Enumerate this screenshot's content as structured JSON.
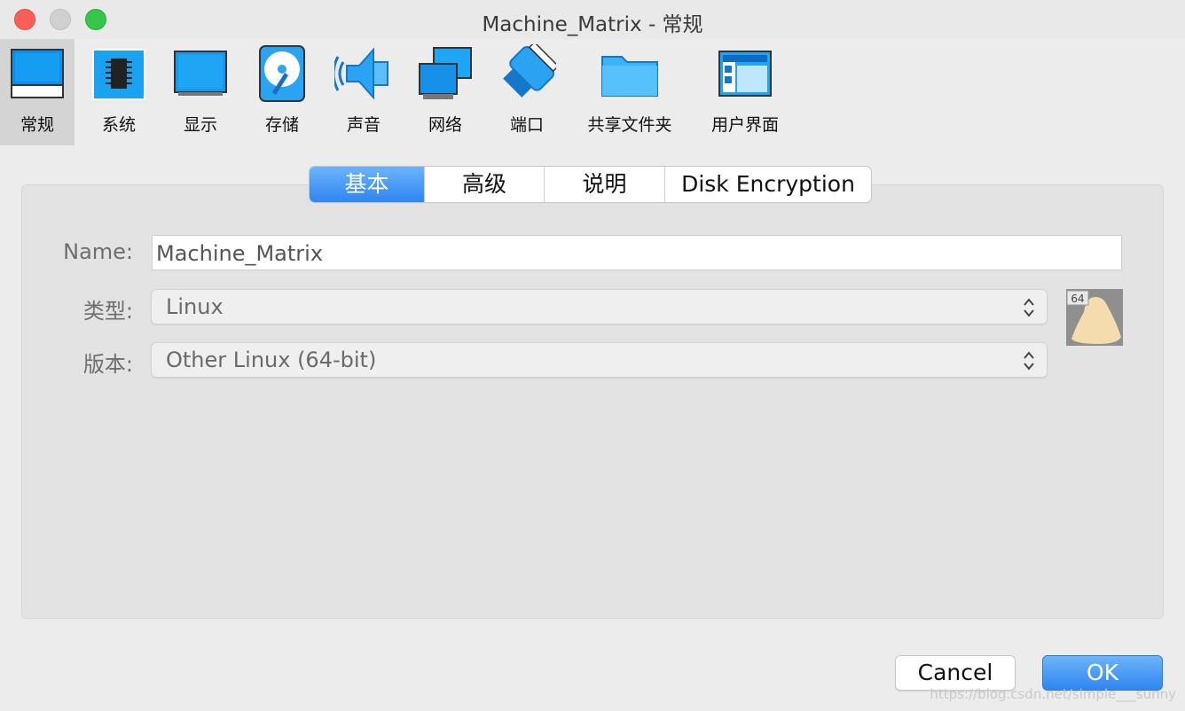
{
  "window": {
    "title": "Machine_Matrix - 常规"
  },
  "toolbar": {
    "items": [
      {
        "label": "常规",
        "icon": "monitor-general-icon"
      },
      {
        "label": "系统",
        "icon": "chip-icon"
      },
      {
        "label": "显示",
        "icon": "display-icon"
      },
      {
        "label": "存储",
        "icon": "storage-disk-icon"
      },
      {
        "label": "声音",
        "icon": "speaker-icon"
      },
      {
        "label": "网络",
        "icon": "network-icon"
      },
      {
        "label": "端口",
        "icon": "port-connector-icon"
      },
      {
        "label": "共享文件夹",
        "icon": "folder-icon"
      },
      {
        "label": "用户界面",
        "icon": "user-interface-icon"
      }
    ]
  },
  "tabs": [
    {
      "label": "基本",
      "active": true
    },
    {
      "label": "高级",
      "active": false
    },
    {
      "label": "说明",
      "active": false
    },
    {
      "label": "Disk Encryption",
      "active": false
    }
  ],
  "form": {
    "name_label": "Name:",
    "name_value": "Machine_Matrix",
    "type_label": "类型:",
    "type_value": "Linux",
    "version_label": "版本:",
    "version_value": "Other Linux (64-bit)",
    "os_badge": "64"
  },
  "buttons": {
    "cancel": "Cancel",
    "ok": "OK"
  },
  "watermark": "https://blog.csdn.net/simple___sunny",
  "colors": {
    "accent": "#2f86f0",
    "close": "#fc5f57",
    "maximize": "#34c748"
  }
}
